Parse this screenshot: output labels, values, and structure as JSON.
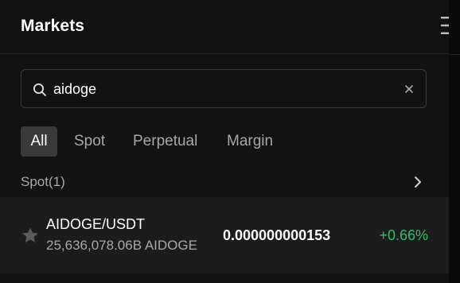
{
  "header": {
    "title": "Markets"
  },
  "search": {
    "value": "aidoge",
    "placeholder": ""
  },
  "tabs": [
    {
      "label": "All",
      "active": true
    },
    {
      "label": "Spot",
      "active": false
    },
    {
      "label": "Perpetual",
      "active": false
    },
    {
      "label": "Margin",
      "active": false
    }
  ],
  "section": {
    "label": "Spot(1)"
  },
  "results": [
    {
      "pair": "AIDOGE/USDT",
      "volume": "25,636,078.06B AIDOGE",
      "price": "0.000000000153",
      "change": "+0.66%",
      "favorited": false
    }
  ],
  "colors": {
    "background": "#121212",
    "row_background": "#1c1c1c",
    "active_tab": "#3a3a3a",
    "positive_change": "#31bd65",
    "muted_text": "#a8a8a8"
  },
  "icons": [
    "search-icon",
    "clear-icon",
    "chevron-right-icon",
    "star-icon",
    "menu-icon"
  ]
}
